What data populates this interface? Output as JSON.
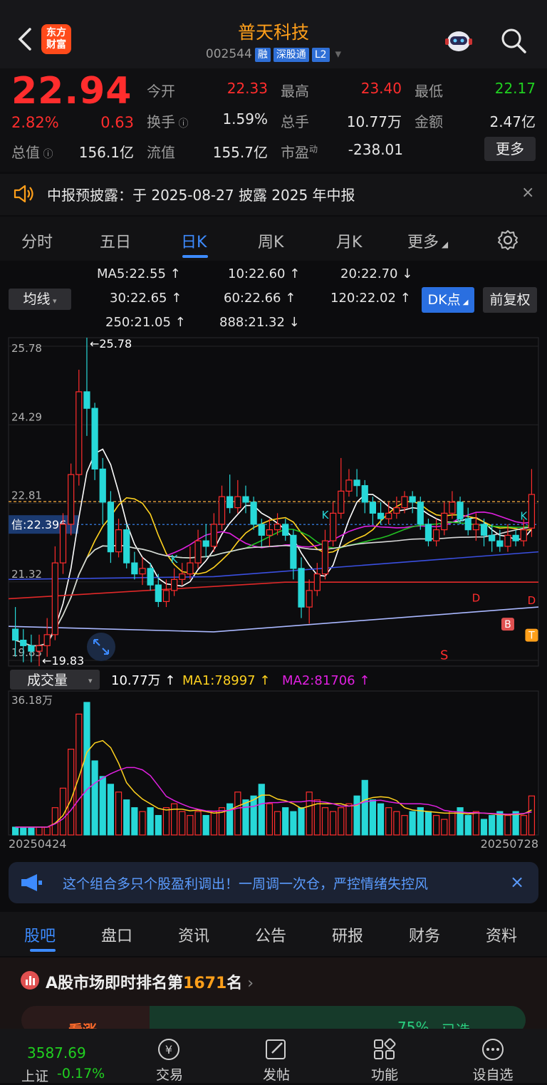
{
  "header": {
    "logo_top": "东方",
    "logo_bottom": "财富",
    "title": "普天科技",
    "code": "002544",
    "tags": [
      "融",
      "深股通",
      "L2"
    ]
  },
  "quote": {
    "price": "22.94",
    "change_pct": "2.82%",
    "change": "0.63",
    "fields": [
      {
        "label": "今开",
        "value": "22.33",
        "color": "red"
      },
      {
        "label": "最高",
        "value": "23.40",
        "color": "red"
      },
      {
        "label": "最低",
        "value": "22.17",
        "color": "green"
      },
      {
        "label": "换手",
        "value": "1.59%",
        "color": "white"
      },
      {
        "label": "总手",
        "value": "10.77万",
        "color": "white"
      },
      {
        "label": "金额",
        "value": "2.47亿",
        "color": "white"
      },
      {
        "label": "总值",
        "value": "156.1亿",
        "color": "white"
      },
      {
        "label": "流值",
        "value": "155.7亿",
        "color": "white"
      },
      {
        "label": "市盈",
        "sup": "动",
        "value": "-238.01",
        "color": "white"
      }
    ],
    "more_label": "更多"
  },
  "notice": {
    "text": "中报预披露：于 2025-08-27 披露 2025 年中报",
    "close": "×"
  },
  "kline_tabs": [
    "分时",
    "五日",
    "日K",
    "周K",
    "月K",
    "更多"
  ],
  "active_tab": "日K",
  "ma_legend": {
    "ma_select": "均线",
    "items": [
      {
        "text": "MA5:22.55 ↑",
        "color": "#ffffff"
      },
      {
        "text": "10:22.60 ↑",
        "color": "#ffd21f"
      },
      {
        "text": "20:22.70 ↓",
        "color": "#e020e0"
      },
      {
        "text": "30:22.65 ↑",
        "color": "#22c022"
      },
      {
        "text": "60:22.66 ↑",
        "color": "#d8d8d8"
      },
      {
        "text": "120:22.02 ↑",
        "color": "#3a4fe0"
      },
      {
        "text": "250:21.05 ↑",
        "color": "#aab8ff"
      },
      {
        "text": "888:21.32 ↓",
        "color": "#e02828"
      }
    ],
    "dk_button": "DK点",
    "adjust_button": "前复权"
  },
  "chart_data": {
    "type": "candlestick",
    "price_axis_ticks": [
      "25.78",
      "24.29",
      "22.81",
      "21.32",
      "19.83"
    ],
    "high_marker": "←25.78",
    "low_marker": "←19.83",
    "signal_label": "信:22.396",
    "current_level": 22.81,
    "signal_level": 22.396,
    "ylim": [
      19.83,
      25.78
    ],
    "candles": [
      [
        20.5,
        20.3,
        20.9,
        20.0
      ],
      [
        20.3,
        20.2,
        20.5,
        19.9
      ],
      [
        20.2,
        20.1,
        20.4,
        19.9
      ],
      [
        20.1,
        20.2,
        20.4,
        19.83
      ],
      [
        20.2,
        20.4,
        20.7,
        20.0
      ],
      [
        20.4,
        21.7,
        22.0,
        20.3
      ],
      [
        21.7,
        22.4,
        22.6,
        21.5
      ],
      [
        22.4,
        23.3,
        23.5,
        22.2
      ],
      [
        23.3,
        24.8,
        25.2,
        23.1
      ],
      [
        24.8,
        24.5,
        25.78,
        24.0
      ],
      [
        24.5,
        23.4,
        24.6,
        23.2
      ],
      [
        23.4,
        22.8,
        23.6,
        22.4
      ],
      [
        22.8,
        21.9,
        23.0,
        21.7
      ],
      [
        21.9,
        22.3,
        22.5,
        21.8
      ],
      [
        22.3,
        21.7,
        22.4,
        21.6
      ],
      [
        21.7,
        21.5,
        21.9,
        21.4
      ],
      [
        21.5,
        21.6,
        21.8,
        21.3
      ],
      [
        21.6,
        21.3,
        21.7,
        21.2
      ],
      [
        21.3,
        21.0,
        21.5,
        20.9
      ],
      [
        21.0,
        21.2,
        21.4,
        20.9
      ],
      [
        21.2,
        21.4,
        21.6,
        21.1
      ],
      [
        21.4,
        21.5,
        21.7,
        21.3
      ],
      [
        21.5,
        21.7,
        22.0,
        21.4
      ],
      [
        21.7,
        22.1,
        22.3,
        21.6
      ],
      [
        22.1,
        22.0,
        22.4,
        21.8
      ],
      [
        22.0,
        22.4,
        22.6,
        21.9
      ],
      [
        22.4,
        22.9,
        23.1,
        22.3
      ],
      [
        22.9,
        22.7,
        23.3,
        22.6
      ],
      [
        22.7,
        22.9,
        23.2,
        22.6
      ],
      [
        22.9,
        22.8,
        23.1,
        22.6
      ],
      [
        22.8,
        22.4,
        22.9,
        22.3
      ],
      [
        22.4,
        22.2,
        22.5,
        22.0
      ],
      [
        22.2,
        22.3,
        22.5,
        22.0
      ],
      [
        22.3,
        22.4,
        22.6,
        22.2
      ],
      [
        22.4,
        22.2,
        22.5,
        22.1
      ],
      [
        22.2,
        21.6,
        22.3,
        21.4
      ],
      [
        21.6,
        20.9,
        21.8,
        20.7
      ],
      [
        20.9,
        21.2,
        21.4,
        20.6
      ],
      [
        21.2,
        21.5,
        21.7,
        21.1
      ],
      [
        21.5,
        22.1,
        22.3,
        21.4
      ],
      [
        22.1,
        22.6,
        22.8,
        22.0
      ],
      [
        22.6,
        23.0,
        23.6,
        22.5
      ],
      [
        23.0,
        23.2,
        23.4,
        22.9
      ],
      [
        23.2,
        23.1,
        23.4,
        22.9
      ],
      [
        23.1,
        22.8,
        23.2,
        22.6
      ],
      [
        22.8,
        22.6,
        22.9,
        22.4
      ],
      [
        22.6,
        22.5,
        22.8,
        22.4
      ],
      [
        22.5,
        22.6,
        22.8,
        22.4
      ],
      [
        22.6,
        22.7,
        22.9,
        22.5
      ],
      [
        22.7,
        22.9,
        23.0,
        22.6
      ],
      [
        22.9,
        22.8,
        23.0,
        22.6
      ],
      [
        22.8,
        22.4,
        22.9,
        22.3
      ],
      [
        22.4,
        22.1,
        22.5,
        22.0
      ],
      [
        22.1,
        22.3,
        22.5,
        22.0
      ],
      [
        22.3,
        22.6,
        22.8,
        22.2
      ],
      [
        22.6,
        22.8,
        23.0,
        22.5
      ],
      [
        22.8,
        22.5,
        22.9,
        22.4
      ],
      [
        22.5,
        22.3,
        22.7,
        22.2
      ],
      [
        22.3,
        22.4,
        22.6,
        22.1
      ],
      [
        22.4,
        22.2,
        22.5,
        22.0
      ],
      [
        22.2,
        22.1,
        22.4,
        21.9
      ],
      [
        22.1,
        22.0,
        22.3,
        21.9
      ],
      [
        22.0,
        22.2,
        22.4,
        21.9
      ],
      [
        22.2,
        22.1,
        22.3,
        22.0
      ],
      [
        22.1,
        22.3,
        22.5,
        22.0
      ],
      [
        22.33,
        22.94,
        23.4,
        22.17
      ]
    ],
    "volume_label": "成交量",
    "volume_legend": [
      {
        "text": "10.77万 ↑",
        "color": "#ffffff"
      },
      {
        "text": "MA1:78997 ↑",
        "color": "#ffd21f"
      },
      {
        "text": "MA2:81706 ↑",
        "color": "#e020e0"
      }
    ],
    "volume_axis_max": "36.18万",
    "volume_max": 36.18,
    "volumes": [
      2,
      2,
      2,
      2,
      2,
      7,
      12,
      22,
      31,
      34,
      19,
      15,
      13,
      11,
      9,
      7,
      6,
      7,
      5,
      7,
      8,
      6,
      5,
      6,
      5,
      6,
      7,
      8,
      11,
      9,
      10,
      13,
      8,
      6,
      7,
      6,
      7,
      11,
      9,
      7,
      6,
      7,
      8,
      10,
      14,
      9,
      8,
      7,
      6,
      5,
      6,
      7,
      6,
      5,
      4,
      6,
      7,
      5,
      6,
      4,
      5,
      6,
      5,
      6,
      5,
      10
    ],
    "date_start": "20250424",
    "date_end": "20250728",
    "markers": [
      "K",
      "K",
      "K",
      "K",
      "D",
      "D",
      "B",
      "T",
      "S"
    ]
  },
  "banner": {
    "text": "这个组合多只个股盈利调出！一周调一次仓，严控情绪失控风",
    "close": "×"
  },
  "footer_tabs": [
    "股吧",
    "盘口",
    "资讯",
    "公告",
    "研报",
    "财务",
    "资料"
  ],
  "active_footer_tab": "股吧",
  "rank": {
    "prefix": "A股市场即时排名第",
    "number": "1671",
    "suffix": "名",
    "bull_label": "看涨",
    "bull_pct": "75%",
    "bull_choice": "已选"
  },
  "bottom_nav": {
    "index_value": "3587.69",
    "index_name": "上证",
    "index_change": "-0.17%",
    "items": [
      "交易",
      "发帖",
      "功能",
      "设自选"
    ]
  }
}
